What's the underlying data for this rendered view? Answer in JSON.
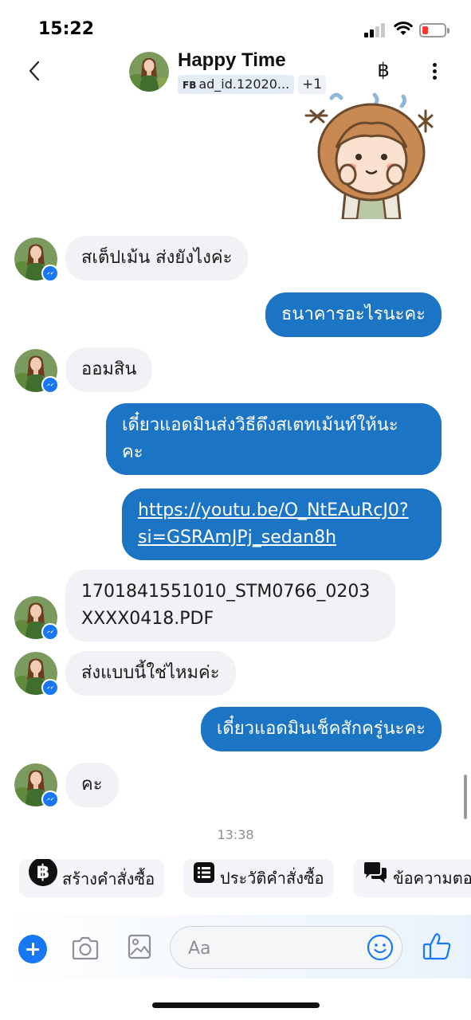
{
  "status_bar": {
    "time": "15:22"
  },
  "header": {
    "title": "Happy Time",
    "fb_badge": "FB",
    "ad_id": "ad_id.12020...",
    "extra_count": "+1",
    "currency_symbol": "฿"
  },
  "messages": [
    {
      "id": "m1",
      "side": "in",
      "text": "สเต็ปเม้น ส่งยังไงค่ะ"
    },
    {
      "id": "m2",
      "side": "out",
      "text": "ธนาคารอะไรนะคะ"
    },
    {
      "id": "m3",
      "side": "in",
      "text": "ออมสิน"
    },
    {
      "id": "m4",
      "side": "out",
      "lines": [
        "เดี๋ยวแอดมินส่งวิธีดึงสเตทเม้นท์ให้นะ",
        "คะ"
      ]
    },
    {
      "id": "m5",
      "side": "out",
      "link": true,
      "lines": [
        "https://youtu.be/O_NtEAuRcJ0?",
        "si=GSRAmJPj_sedan8h"
      ]
    },
    {
      "id": "m6",
      "side": "in",
      "lines": [
        "1701841551010_STM0766_0203",
        "XXXX0418.PDF"
      ]
    },
    {
      "id": "m7",
      "side": "in",
      "text": "ส่งแบบนี้ใช่ไหมค่ะ"
    },
    {
      "id": "m8",
      "side": "out",
      "text": "เดี๋ยวแอดมินเช็คสักครู่นะคะ"
    },
    {
      "id": "m9",
      "side": "in",
      "text": "คะ"
    }
  ],
  "timestamp": "13:38",
  "quick_actions": [
    {
      "label": "สร้างคำสั่งซื้อ",
      "icon": "baht-circle-icon"
    },
    {
      "label": "ประวัติคำสั่งซื้อ",
      "icon": "order-list-icon"
    },
    {
      "label": "ข้อความตอ",
      "icon": "chat-bubbles-icon"
    }
  ],
  "composer": {
    "placeholder": "Aa"
  },
  "colors": {
    "outgoing_bubble": "#1b74c4",
    "incoming_bubble": "#f1f2f5",
    "accent": "#1877f2"
  }
}
